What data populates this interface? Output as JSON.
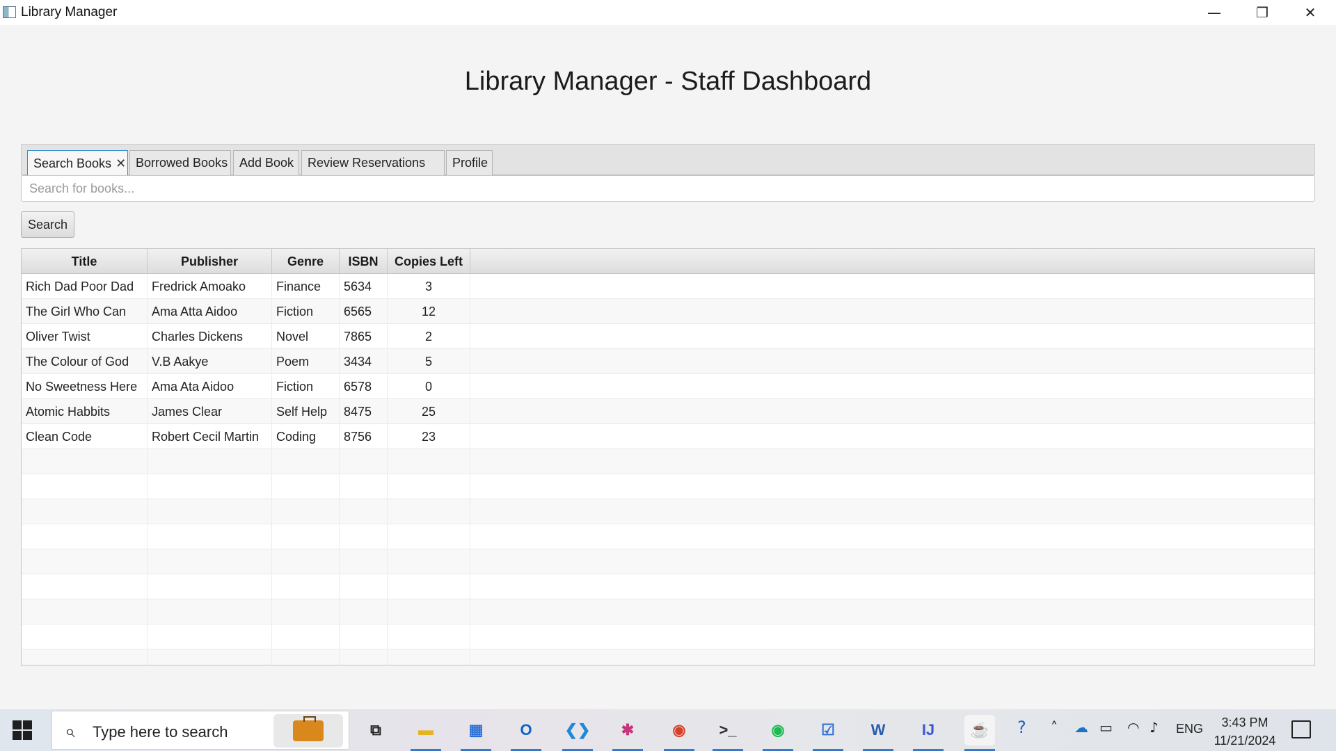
{
  "window": {
    "title": "Library Manager",
    "controls": {
      "minimize": "—",
      "maximize": "❐",
      "close": "✕"
    }
  },
  "page": {
    "title": "Library Manager - Staff Dashboard"
  },
  "tabs": [
    {
      "label": "Search Books",
      "active": true,
      "closable": true
    },
    {
      "label": "Borrowed Books",
      "active": false
    },
    {
      "label": "Add Book",
      "active": false
    },
    {
      "label": "Review Reservations",
      "active": false
    },
    {
      "label": "Profile",
      "active": false
    }
  ],
  "search": {
    "placeholder": "Search for books...",
    "value": "",
    "button_label": "Search"
  },
  "table": {
    "columns": [
      "Title",
      "Publisher",
      "Genre",
      "ISBN",
      "Copies Left"
    ],
    "rows": [
      [
        "Rich Dad Poor Dad",
        "Fredrick Amoako",
        "Finance",
        "5634",
        "3"
      ],
      [
        "The Girl Who Can",
        "Ama Atta Aidoo",
        "Fiction",
        "6565",
        "12"
      ],
      [
        "Oliver Twist",
        "Charles Dickens",
        "Novel",
        "7865",
        "2"
      ],
      [
        "The Colour of God",
        "V.B Aakye",
        "Poem",
        "3434",
        "5"
      ],
      [
        "No Sweetness Here",
        "Ama Ata Aidoo",
        "Fiction",
        "6578",
        "0"
      ],
      [
        "Atomic Habbits",
        "James Clear",
        "Self Help",
        "8475",
        "25"
      ],
      [
        "Clean Code",
        "Robert Cecil Martin",
        "Coding",
        "8756",
        "23"
      ]
    ],
    "empty_rows": 9
  },
  "taskbar": {
    "search_placeholder": "Type here to search",
    "apps": [
      {
        "name": "task-view",
        "glyph": "⧉",
        "color": "#222222"
      },
      {
        "name": "file-explorer",
        "glyph": "▬",
        "color": "#e6b422"
      },
      {
        "name": "microsoft-store",
        "glyph": "▦",
        "color": "#2b6fd6"
      },
      {
        "name": "outlook",
        "glyph": "O",
        "color": "#0a64c8"
      },
      {
        "name": "vscode",
        "glyph": "❮❯",
        "color": "#1e88d8"
      },
      {
        "name": "slack",
        "glyph": "✱",
        "color": "#c5367a"
      },
      {
        "name": "chrome",
        "glyph": "◉",
        "color": "#d9402b"
      },
      {
        "name": "terminal",
        "glyph": ">_",
        "color": "#2b2b2b"
      },
      {
        "name": "spotify",
        "glyph": "◉",
        "color": "#1db954"
      },
      {
        "name": "todo",
        "glyph": "☑",
        "color": "#2f6fd6"
      },
      {
        "name": "word",
        "glyph": "W",
        "color": "#2b5cad"
      },
      {
        "name": "intellij",
        "glyph": "IJ",
        "color": "#3a56d6"
      },
      {
        "name": "java",
        "glyph": "☕",
        "color": "#e0682c"
      }
    ],
    "tray": {
      "language": "ENG",
      "time": "3:43 PM",
      "date": "11/21/2024"
    }
  }
}
